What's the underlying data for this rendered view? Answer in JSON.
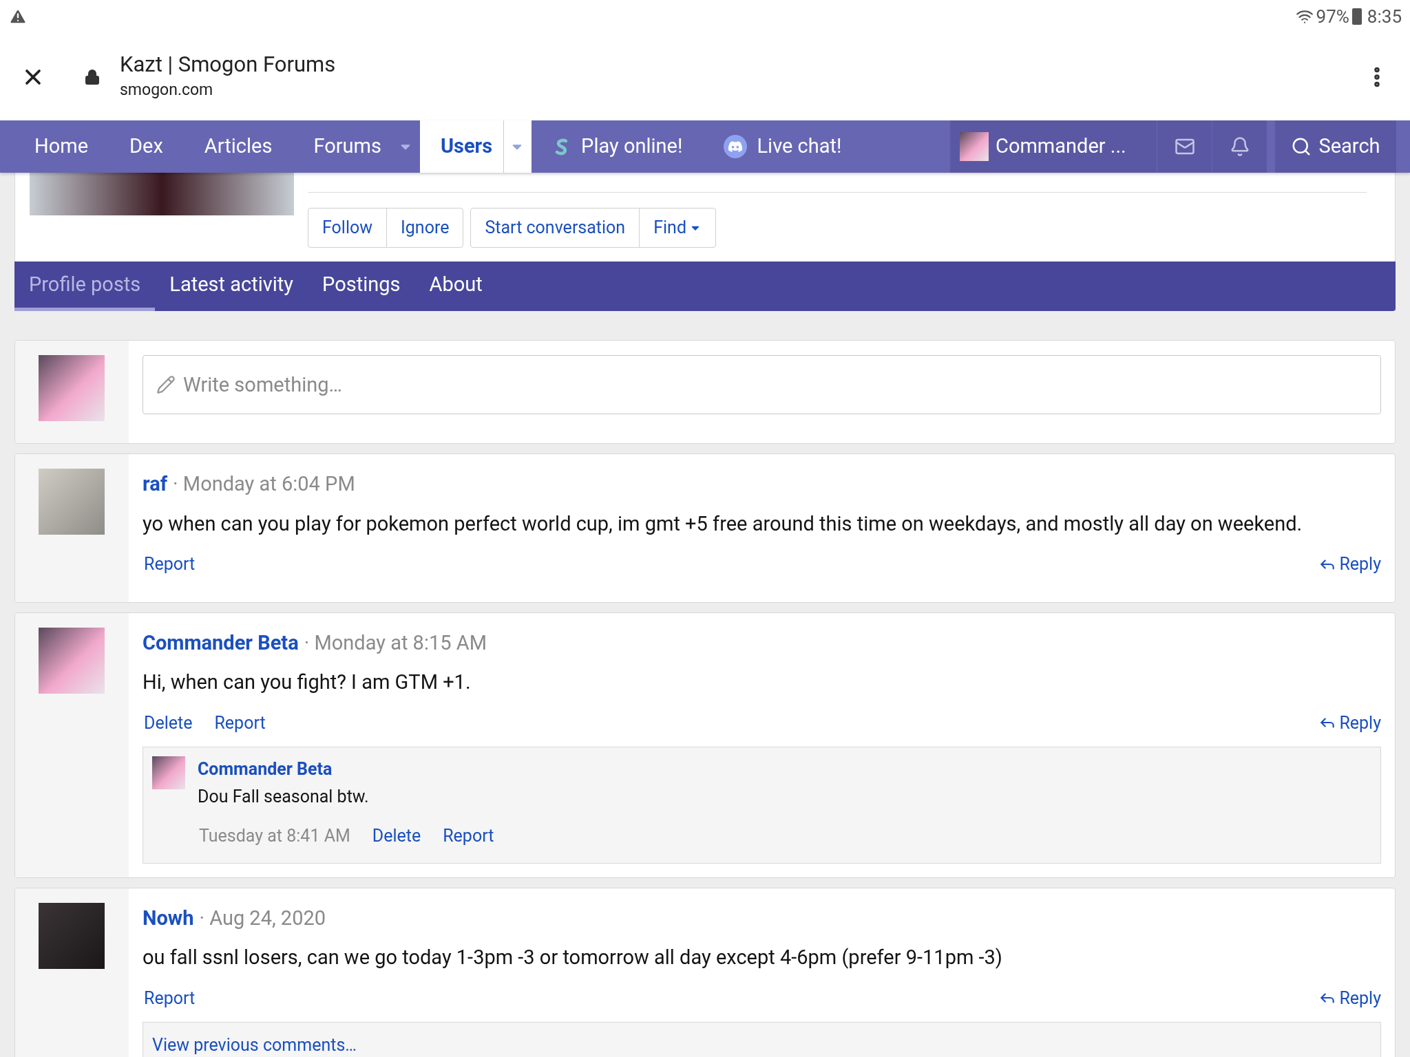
{
  "status_bar": {
    "battery": "97%",
    "time": "8:35"
  },
  "browser": {
    "title": "Kazt | Smogon Forums",
    "url": "smogon.com"
  },
  "nav": {
    "items": [
      {
        "label": "Home",
        "selected": false,
        "dropdown": false,
        "kind": "plain"
      },
      {
        "label": "Dex",
        "selected": false,
        "dropdown": false,
        "kind": "plain"
      },
      {
        "label": "Articles",
        "selected": false,
        "dropdown": false,
        "kind": "plain"
      },
      {
        "label": "Forums",
        "selected": false,
        "dropdown": true,
        "kind": "plain"
      },
      {
        "label": "Users",
        "selected": true,
        "dropdown": true,
        "kind": "plain"
      },
      {
        "label": "Play online!",
        "selected": false,
        "dropdown": false,
        "kind": "showdown"
      },
      {
        "label": "Live chat!",
        "selected": false,
        "dropdown": false,
        "kind": "discord"
      }
    ],
    "user": "Commander ...",
    "search": "Search"
  },
  "profile": {
    "button_groups": [
      [
        {
          "label": "Follow",
          "dropdown": false
        },
        {
          "label": "Ignore",
          "dropdown": false
        }
      ],
      [
        {
          "label": "Start conversation",
          "dropdown": false
        },
        {
          "label": "Find",
          "dropdown": true
        }
      ]
    ],
    "tabs": [
      {
        "label": "Profile posts",
        "selected": true
      },
      {
        "label": "Latest activity",
        "selected": false
      },
      {
        "label": "Postings",
        "selected": false
      },
      {
        "label": "About",
        "selected": false
      }
    ]
  },
  "composer": {
    "placeholder": "Write something…"
  },
  "posts": [
    {
      "author": "raf",
      "time": "· Monday at 6:04 PM",
      "kind": "gray",
      "message": "yo when can you play for pokemon perfect world cup, im gmt +5 free around this time on weekdays, and mostly all day on weekend.",
      "actions": [
        "Report"
      ],
      "reply": "Reply"
    },
    {
      "author": "Commander Beta",
      "time": "· Monday at 8:15 AM",
      "kind": "pink",
      "message": "Hi, when can you fight? I am GTM +1.",
      "actions": [
        "Delete",
        "Report"
      ],
      "reply": "Reply",
      "comments": [
        {
          "author": "Commander Beta",
          "message": "Dou Fall seasonal btw.",
          "time": "Tuesday at 8:41 AM",
          "actions": [
            "Delete",
            "Report"
          ]
        }
      ]
    },
    {
      "author": "Nowh",
      "time": "· Aug 24, 2020",
      "kind": "dark",
      "message": "ou fall ssnl losers, can we go today 1-3pm -3 or tomorrow all day except 4-6pm (prefer 9-11pm -3)",
      "actions": [
        "Report"
      ],
      "reply": "Reply",
      "more": "View previous comments…"
    }
  ]
}
